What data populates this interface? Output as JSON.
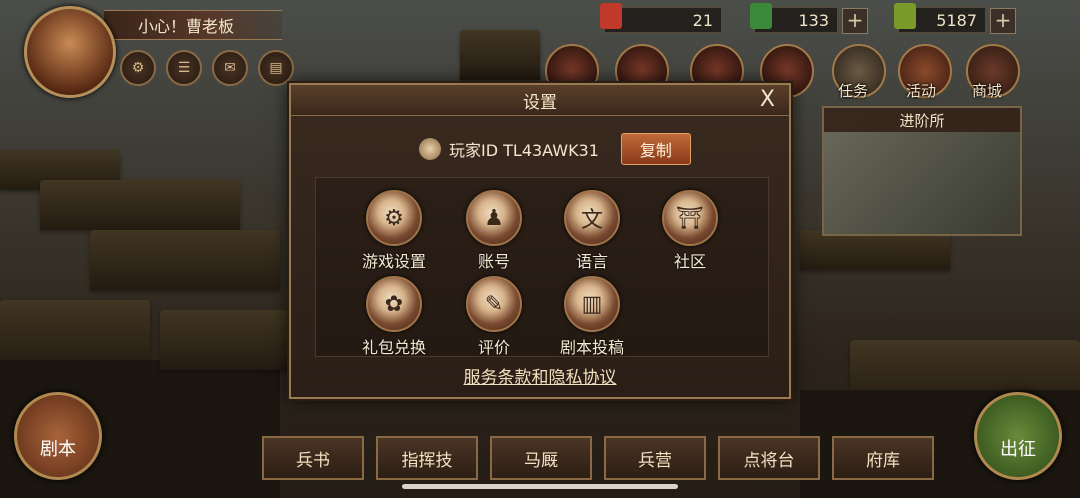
{
  "player": {
    "name_banner": "小心！曹老板"
  },
  "resources": [
    {
      "value": "21",
      "color": "#c0392b"
    },
    {
      "value": "133",
      "color": "#3a8a3a"
    },
    {
      "value": "5187",
      "color": "#7a9a2a"
    }
  ],
  "top_nav": [
    {
      "label": "任务"
    },
    {
      "label": "活动"
    },
    {
      "label": "商城"
    }
  ],
  "promo": {
    "title": "进阶所"
  },
  "dialog": {
    "title": "设置",
    "close_label": "X",
    "player_id": "玩家ID TL43AWK31",
    "copy_label": "复制",
    "options": [
      {
        "label": "游戏设置",
        "icon": "gears-icon"
      },
      {
        "label": "账号",
        "icon": "person-icon"
      },
      {
        "label": "语言",
        "icon": "language-icon"
      },
      {
        "label": "社区",
        "icon": "gate-icon"
      },
      {
        "label": "礼包兑换",
        "icon": "bag-icon"
      },
      {
        "label": "评价",
        "icon": "scroll-quill-icon"
      },
      {
        "label": "剧本投稿",
        "icon": "scroll-icon"
      }
    ],
    "terms_link": "服务条款和隐私协议"
  },
  "bottom_nav": [
    {
      "label": "兵书"
    },
    {
      "label": "指挥技"
    },
    {
      "label": "马厩"
    },
    {
      "label": "兵营"
    },
    {
      "label": "点将台"
    },
    {
      "label": "府库"
    }
  ],
  "left_round": "剧本",
  "right_round": "出征",
  "colors": {
    "accent": "#9a7a50",
    "copy_button": "#b5582c"
  }
}
